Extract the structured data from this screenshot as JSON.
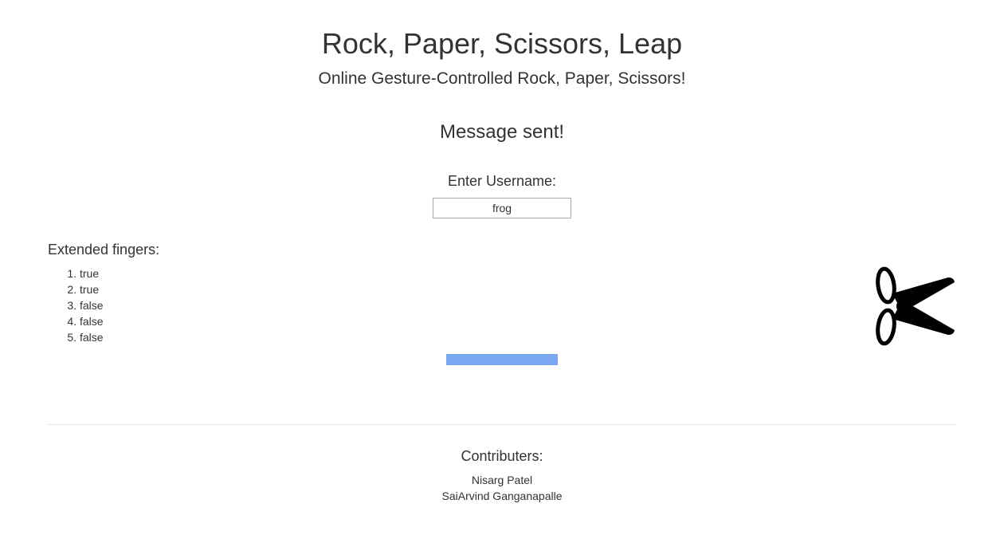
{
  "header": {
    "title": "Rock, Paper, Scissors, Leap",
    "subtitle": "Online Gesture-Controlled Rock, Paper, Scissors!"
  },
  "status": {
    "message": "Message sent!"
  },
  "username": {
    "label": "Enter Username:",
    "value": "frog"
  },
  "fingers": {
    "heading": "Extended fingers:",
    "items": [
      "true",
      "true",
      "false",
      "false",
      "false"
    ]
  },
  "gesture": {
    "icon": "scissors-icon"
  },
  "progress": {
    "fraction": 1.0,
    "color": "#7aa8f0"
  },
  "footer": {
    "heading": "Contributers:",
    "contributors": [
      "Nisarg Patel",
      "SaiArvind Ganganapalle"
    ]
  }
}
